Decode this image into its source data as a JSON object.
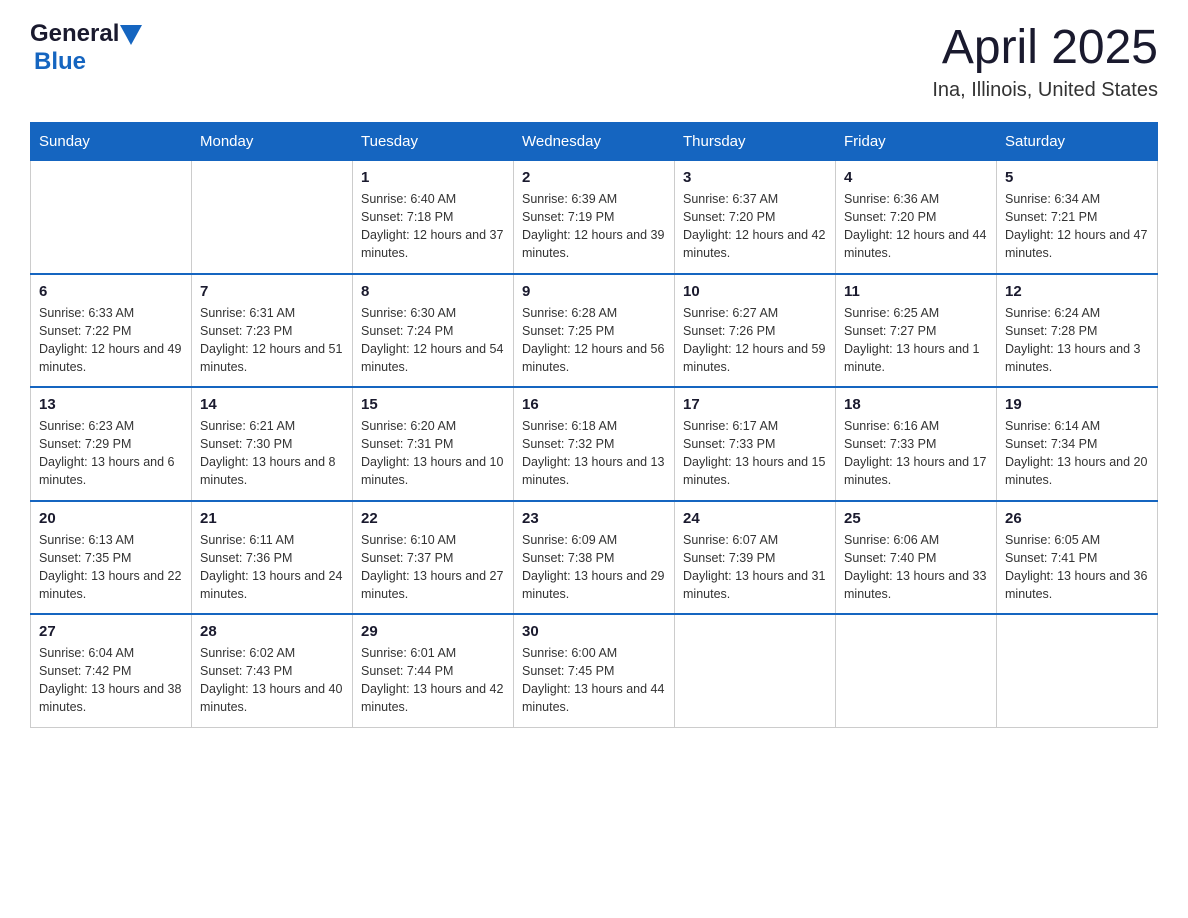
{
  "header": {
    "logo_general": "General",
    "logo_blue": "Blue",
    "month": "April 2025",
    "location": "Ina, Illinois, United States"
  },
  "days_of_week": [
    "Sunday",
    "Monday",
    "Tuesday",
    "Wednesday",
    "Thursday",
    "Friday",
    "Saturday"
  ],
  "weeks": [
    [
      {
        "day": "",
        "sunrise": "",
        "sunset": "",
        "daylight": ""
      },
      {
        "day": "",
        "sunrise": "",
        "sunset": "",
        "daylight": ""
      },
      {
        "day": "1",
        "sunrise": "Sunrise: 6:40 AM",
        "sunset": "Sunset: 7:18 PM",
        "daylight": "Daylight: 12 hours and 37 minutes."
      },
      {
        "day": "2",
        "sunrise": "Sunrise: 6:39 AM",
        "sunset": "Sunset: 7:19 PM",
        "daylight": "Daylight: 12 hours and 39 minutes."
      },
      {
        "day": "3",
        "sunrise": "Sunrise: 6:37 AM",
        "sunset": "Sunset: 7:20 PM",
        "daylight": "Daylight: 12 hours and 42 minutes."
      },
      {
        "day": "4",
        "sunrise": "Sunrise: 6:36 AM",
        "sunset": "Sunset: 7:20 PM",
        "daylight": "Daylight: 12 hours and 44 minutes."
      },
      {
        "day": "5",
        "sunrise": "Sunrise: 6:34 AM",
        "sunset": "Sunset: 7:21 PM",
        "daylight": "Daylight: 12 hours and 47 minutes."
      }
    ],
    [
      {
        "day": "6",
        "sunrise": "Sunrise: 6:33 AM",
        "sunset": "Sunset: 7:22 PM",
        "daylight": "Daylight: 12 hours and 49 minutes."
      },
      {
        "day": "7",
        "sunrise": "Sunrise: 6:31 AM",
        "sunset": "Sunset: 7:23 PM",
        "daylight": "Daylight: 12 hours and 51 minutes."
      },
      {
        "day": "8",
        "sunrise": "Sunrise: 6:30 AM",
        "sunset": "Sunset: 7:24 PM",
        "daylight": "Daylight: 12 hours and 54 minutes."
      },
      {
        "day": "9",
        "sunrise": "Sunrise: 6:28 AM",
        "sunset": "Sunset: 7:25 PM",
        "daylight": "Daylight: 12 hours and 56 minutes."
      },
      {
        "day": "10",
        "sunrise": "Sunrise: 6:27 AM",
        "sunset": "Sunset: 7:26 PM",
        "daylight": "Daylight: 12 hours and 59 minutes."
      },
      {
        "day": "11",
        "sunrise": "Sunrise: 6:25 AM",
        "sunset": "Sunset: 7:27 PM",
        "daylight": "Daylight: 13 hours and 1 minute."
      },
      {
        "day": "12",
        "sunrise": "Sunrise: 6:24 AM",
        "sunset": "Sunset: 7:28 PM",
        "daylight": "Daylight: 13 hours and 3 minutes."
      }
    ],
    [
      {
        "day": "13",
        "sunrise": "Sunrise: 6:23 AM",
        "sunset": "Sunset: 7:29 PM",
        "daylight": "Daylight: 13 hours and 6 minutes."
      },
      {
        "day": "14",
        "sunrise": "Sunrise: 6:21 AM",
        "sunset": "Sunset: 7:30 PM",
        "daylight": "Daylight: 13 hours and 8 minutes."
      },
      {
        "day": "15",
        "sunrise": "Sunrise: 6:20 AM",
        "sunset": "Sunset: 7:31 PM",
        "daylight": "Daylight: 13 hours and 10 minutes."
      },
      {
        "day": "16",
        "sunrise": "Sunrise: 6:18 AM",
        "sunset": "Sunset: 7:32 PM",
        "daylight": "Daylight: 13 hours and 13 minutes."
      },
      {
        "day": "17",
        "sunrise": "Sunrise: 6:17 AM",
        "sunset": "Sunset: 7:33 PM",
        "daylight": "Daylight: 13 hours and 15 minutes."
      },
      {
        "day": "18",
        "sunrise": "Sunrise: 6:16 AM",
        "sunset": "Sunset: 7:33 PM",
        "daylight": "Daylight: 13 hours and 17 minutes."
      },
      {
        "day": "19",
        "sunrise": "Sunrise: 6:14 AM",
        "sunset": "Sunset: 7:34 PM",
        "daylight": "Daylight: 13 hours and 20 minutes."
      }
    ],
    [
      {
        "day": "20",
        "sunrise": "Sunrise: 6:13 AM",
        "sunset": "Sunset: 7:35 PM",
        "daylight": "Daylight: 13 hours and 22 minutes."
      },
      {
        "day": "21",
        "sunrise": "Sunrise: 6:11 AM",
        "sunset": "Sunset: 7:36 PM",
        "daylight": "Daylight: 13 hours and 24 minutes."
      },
      {
        "day": "22",
        "sunrise": "Sunrise: 6:10 AM",
        "sunset": "Sunset: 7:37 PM",
        "daylight": "Daylight: 13 hours and 27 minutes."
      },
      {
        "day": "23",
        "sunrise": "Sunrise: 6:09 AM",
        "sunset": "Sunset: 7:38 PM",
        "daylight": "Daylight: 13 hours and 29 minutes."
      },
      {
        "day": "24",
        "sunrise": "Sunrise: 6:07 AM",
        "sunset": "Sunset: 7:39 PM",
        "daylight": "Daylight: 13 hours and 31 minutes."
      },
      {
        "day": "25",
        "sunrise": "Sunrise: 6:06 AM",
        "sunset": "Sunset: 7:40 PM",
        "daylight": "Daylight: 13 hours and 33 minutes."
      },
      {
        "day": "26",
        "sunrise": "Sunrise: 6:05 AM",
        "sunset": "Sunset: 7:41 PM",
        "daylight": "Daylight: 13 hours and 36 minutes."
      }
    ],
    [
      {
        "day": "27",
        "sunrise": "Sunrise: 6:04 AM",
        "sunset": "Sunset: 7:42 PM",
        "daylight": "Daylight: 13 hours and 38 minutes."
      },
      {
        "day": "28",
        "sunrise": "Sunrise: 6:02 AM",
        "sunset": "Sunset: 7:43 PM",
        "daylight": "Daylight: 13 hours and 40 minutes."
      },
      {
        "day": "29",
        "sunrise": "Sunrise: 6:01 AM",
        "sunset": "Sunset: 7:44 PM",
        "daylight": "Daylight: 13 hours and 42 minutes."
      },
      {
        "day": "30",
        "sunrise": "Sunrise: 6:00 AM",
        "sunset": "Sunset: 7:45 PM",
        "daylight": "Daylight: 13 hours and 44 minutes."
      },
      {
        "day": "",
        "sunrise": "",
        "sunset": "",
        "daylight": ""
      },
      {
        "day": "",
        "sunrise": "",
        "sunset": "",
        "daylight": ""
      },
      {
        "day": "",
        "sunrise": "",
        "sunset": "",
        "daylight": ""
      }
    ]
  ]
}
